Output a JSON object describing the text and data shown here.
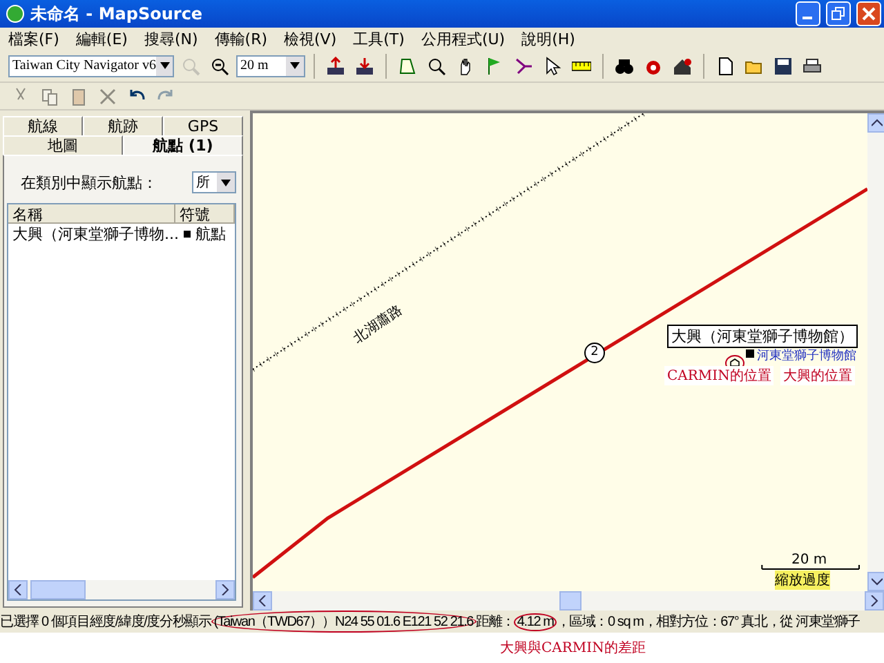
{
  "window": {
    "title": "未命名 - MapSource"
  },
  "menu": [
    "檔案(F)",
    "編輯(E)",
    "搜尋(N)",
    "傳輸(R)",
    "檢視(V)",
    "工具(T)",
    "公用程式(U)",
    "說明(H)"
  ],
  "toolbar": {
    "product": "Taiwan City Navigator v6",
    "zoom": "20 m"
  },
  "back_tabs": [
    {
      "label": "航線",
      "selected": false
    },
    {
      "label": "航跡",
      "selected": false
    },
    {
      "label": "GPS",
      "selected": false
    }
  ],
  "front_tabs": [
    {
      "label": "地圖",
      "selected": false
    },
    {
      "label": "航點 (1)",
      "selected": true
    }
  ],
  "filter": {
    "label": "在類別中顯示航點：",
    "value": "所"
  },
  "table": {
    "columns": [
      "名稱",
      "符號"
    ],
    "rows": [
      {
        "name": "大興（河東堂獅子博物...",
        "symbol": "航點",
        "selected": false
      }
    ]
  },
  "map": {
    "road_label": "北湖蕭路",
    "route_marker": "2",
    "waypoint_label": "大興（河東堂獅子博物館）",
    "poi_label": "河東堂獅子博物館",
    "scale": "20 m",
    "zoom_warning": "縮放過度"
  },
  "annotations": {
    "gps_position": "CARMIN的位置",
    "waypoint_position": "大興的位置",
    "distance_note": "大興與CARMIN的差距"
  },
  "status_bar": {
    "selection": "已選擇 0 個項目",
    "format": "經度/緯度/度分秒顯示",
    "datum": "(Taiwan（TWD67））",
    "coordinates": "N24 55 01.6 E121 52 21.6",
    "distance_label": "距離：",
    "distance": "4.12 m",
    "details": "，區域：0 sq m，相對方位：67° 真北，從 河東堂獅子"
  }
}
